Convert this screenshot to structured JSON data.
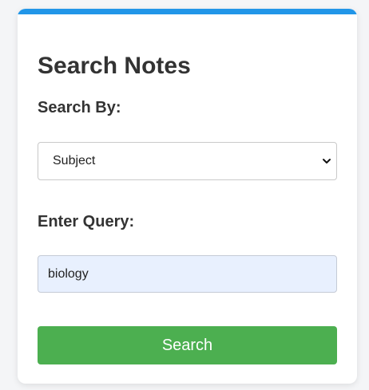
{
  "form": {
    "title": "Search Notes",
    "search_by_label": "Search By:",
    "search_by_selected": "Subject",
    "query_label": "Enter Query:",
    "query_value": "biology",
    "search_button_label": "Search"
  },
  "colors": {
    "accent": "#2196e8",
    "button": "#4caf50",
    "input_fill": "#e8f0fe"
  },
  "icons": {
    "select_arrow": "chevron-down-icon"
  }
}
